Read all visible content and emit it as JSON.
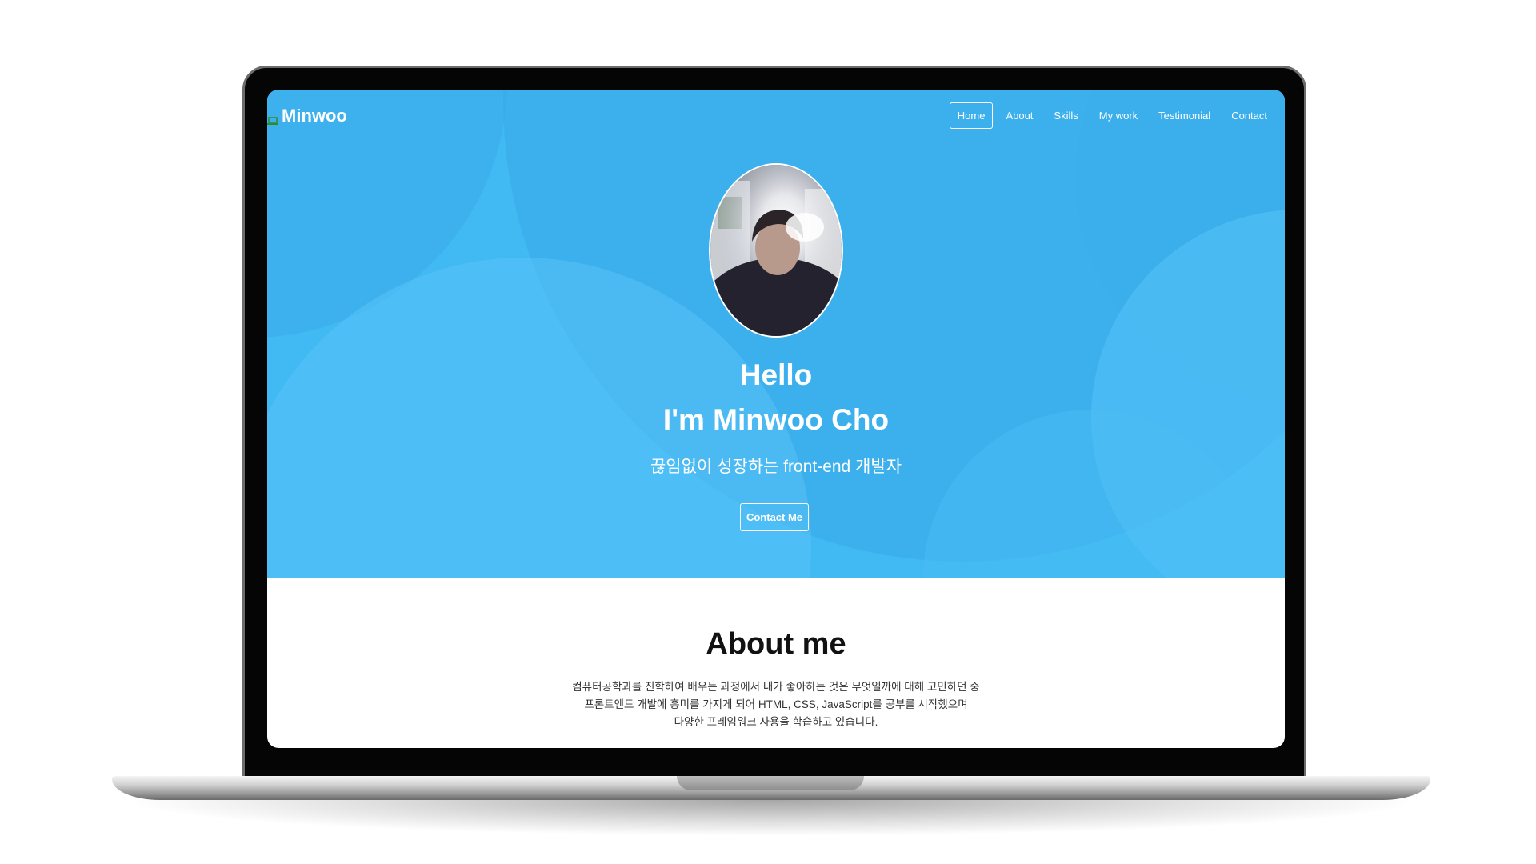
{
  "brand": {
    "name": "Minwoo"
  },
  "nav": {
    "items": [
      {
        "label": "Home",
        "active": true
      },
      {
        "label": "About",
        "active": false
      },
      {
        "label": "Skills",
        "active": false
      },
      {
        "label": "My work",
        "active": false
      },
      {
        "label": "Testimonial",
        "active": false
      },
      {
        "label": "Contact",
        "active": false
      }
    ]
  },
  "hero": {
    "line1": "Hello",
    "line2": "I'm Minwoo Cho",
    "subtitle": "끊임없이 성장하는 front-end 개발자",
    "contact_button": "Contact Me"
  },
  "about": {
    "title": "About me",
    "lines": [
      "컴퓨터공학과를 진학하여 배우는 과정에서 내가 좋아하는 것은 무엇일까에 대해 고민하던 중",
      "프론트엔드 개발에 흥미를 가지게 되어 HTML, CSS, JavaScript를 공부를 시작했으며",
      "다양한 프레임워크 사용을 학습하고 있습니다."
    ]
  },
  "colors": {
    "hero_background": "#41b9f3",
    "text_light": "#ffffff",
    "text_dark": "#111111",
    "laptop_bezel": "#050505"
  },
  "icons": {
    "brand": "laptop-logo-icon"
  }
}
